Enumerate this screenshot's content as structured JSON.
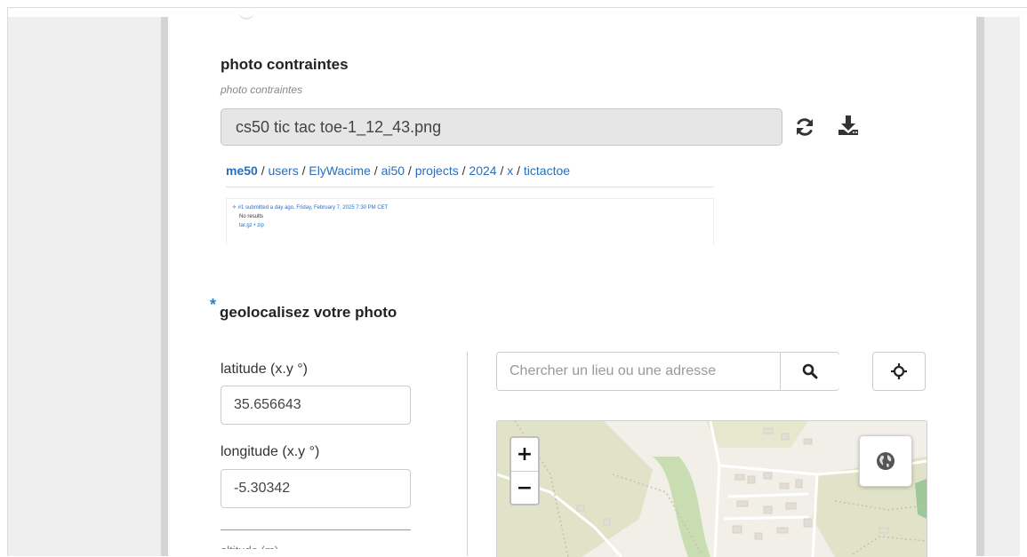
{
  "photo_section": {
    "title": "photo contraintes",
    "subtitle": "photo contraintes",
    "filename": "cs50 tic tac toe-1_12_43.png",
    "refresh_icon": "refresh-icon",
    "download_icon": "download-icon"
  },
  "breadcrumb": {
    "repo": "me50",
    "sep": " / ",
    "parts": [
      "users",
      "ElyWacime",
      "ai50",
      "projects",
      "2024",
      "x",
      "tictactoe"
    ]
  },
  "preview": {
    "submission": "#1 submitted a day ago, Friday, February 7, 2025 7:30 PM CET",
    "result": "No results",
    "downloads": "tar.gz • zip"
  },
  "geo_section": {
    "required_mark": "*",
    "title": "geolocalisez votre photo",
    "latitude_label": "latitude (x.y °)",
    "latitude_value": "35.656643",
    "longitude_label": "longitude (x.y °)",
    "longitude_value": "-5.30342",
    "cutoff_label": "altitude (m)"
  },
  "map_search": {
    "placeholder": "Chercher un lieu ou une adresse",
    "search_icon": "search-icon",
    "locate_icon": "crosshair-icon"
  },
  "map": {
    "zoom_in": "+",
    "zoom_out": "−",
    "layers_icon": "globe-icon"
  },
  "colors": {
    "link": "#2a6ebb",
    "required": "#2a7fc4",
    "gutter": "#efefef"
  }
}
